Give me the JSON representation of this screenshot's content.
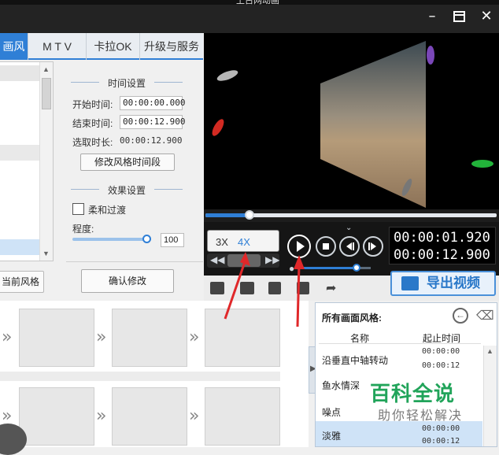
{
  "window": {
    "title": "上古网动画"
  },
  "tabs": [
    {
      "label": "画风格",
      "active": true
    },
    {
      "label": "M T V"
    },
    {
      "label": "卡拉OK"
    },
    {
      "label": "升级与服务"
    }
  ],
  "left_panel": {
    "current_style_button": "当前风格"
  },
  "time_settings": {
    "title": "时间设置",
    "start_label": "开始时间:",
    "start_value": "00:00:00.000",
    "end_label": "结束时间:",
    "end_value": "00:00:12.900",
    "duration_label": "选取时长:",
    "duration_value": "00:00:12.900",
    "modify_button": "修改风格时间段"
  },
  "effect_settings": {
    "title": "效果设置",
    "soft_transition_label": "柔和过渡",
    "soft_transition_checked": false,
    "degree_label": "程度:",
    "degree_value": "100",
    "degree_fraction": 1.0
  },
  "confirm_button": "确认修改",
  "player": {
    "speed_options": [
      "3X",
      "4X"
    ],
    "speed_selected": "4X",
    "current_time": "00:00:01.920",
    "total_time": "00:00:12.900",
    "progress_fraction": 0.15,
    "volume_fraction": 0.8
  },
  "export_button": "导出视频",
  "style_list": {
    "title": "所有画面风格:",
    "col_name": "名称",
    "col_time": "起止时间",
    "rows": [
      {
        "name": "沿垂直中轴转动",
        "start": "00:00:00",
        "end": "00:00:12"
      },
      {
        "name": "鱼水情深",
        "start": "",
        "end": ""
      },
      {
        "name": "噪点",
        "start": "",
        "end": ""
      },
      {
        "name": "淡雅",
        "start": "00:00:00",
        "end": "00:00:12",
        "selected": true
      }
    ]
  },
  "watermark": {
    "line1": "百科全说",
    "line2": "助你轻松解决"
  },
  "colors": {
    "accent": "#2f7fd6",
    "annotation": "#e0282a",
    "watermark": "#21a45a"
  }
}
